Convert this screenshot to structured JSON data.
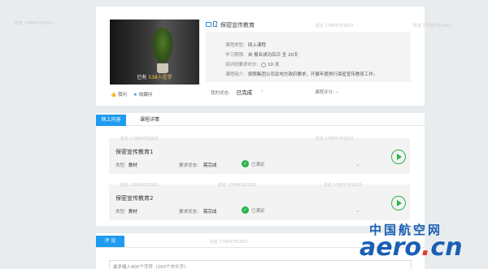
{
  "course": {
    "cover_caption_prefix": "已有",
    "cover_caption_highlight": "538人在学",
    "title": "保密宣传教育",
    "meta": [
      {
        "key": "课程类型:",
        "value": "网上课程"
      },
      {
        "key": "学习期限:",
        "value": "自 报名成功后日 至 20天"
      },
      {
        "key": "培训班要求时长:",
        "value": "10 天"
      },
      {
        "key": "课程简介:",
        "value": "按照集团公司及地方政府要求，开展年度例行保密宣传教育工作。"
      }
    ],
    "status_label": "我的状态:",
    "status_value": "已完成",
    "score_label": "课程评分:",
    "score_value": "--",
    "actions": {
      "ask": "我问",
      "favorite": "收藏问"
    }
  },
  "tabs": {
    "active": "网上内容",
    "normal": "课程详情"
  },
  "items": [
    {
      "name": "保密宣传教育1",
      "type_label": "类型:",
      "type_value": "教材",
      "req_label": "要求状态:",
      "req_value": "需完成",
      "done": "已满足"
    },
    {
      "name": "保密宣传教育2",
      "type_label": "类型:",
      "type_value": "教材",
      "req_label": "要求状态:",
      "req_value": "需完成",
      "done": "已满足"
    }
  ],
  "comment": {
    "tab": "评 论",
    "placeholder": "最多输入400个字符（200个中文字）"
  },
  "watermark": "姓名 17684761803",
  "logo": {
    "cn": "中国航空网",
    "en_main": "aero",
    "en_dot": ".",
    "en_tld": "cn"
  }
}
